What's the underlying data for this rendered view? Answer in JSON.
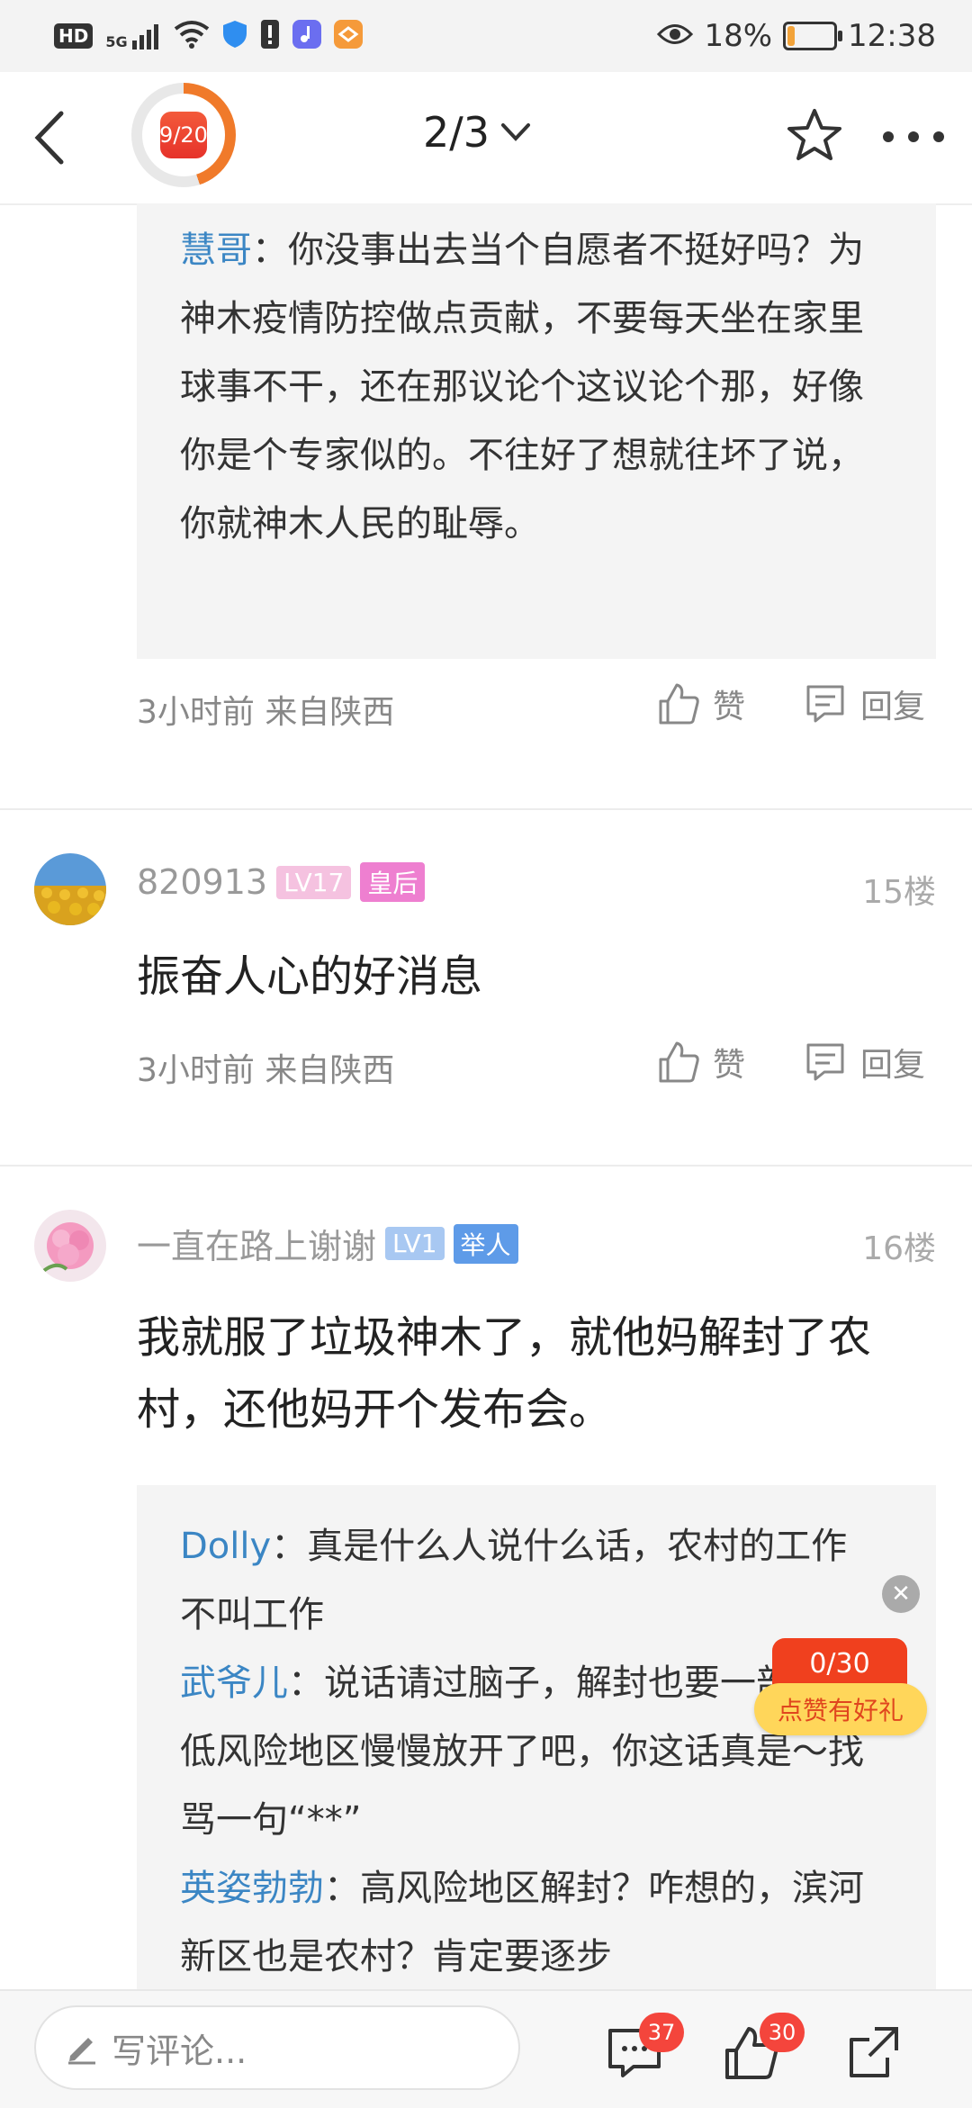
{
  "status": {
    "hd": "HD",
    "signal": "5G",
    "battery_pct": "18%",
    "battery_level": 0.18,
    "time": "12:38"
  },
  "nav": {
    "timer": "9/20",
    "timer_progress": 0.45,
    "page": "2/3"
  },
  "comment14": {
    "replies": [
      {
        "name": "慧哥",
        "text": "：你没事出去当个自愿者不挺好吗？为神木疫情防控做点贡献，不要每天坐在家里球事不干，还在那议论个这议论个那，好像你是个专家似的。不往好了想就往坏了说，你就神木人民的耻辱。"
      }
    ],
    "time": "3小时前 来自陕西",
    "like": "赞",
    "reply": "回复"
  },
  "comment15": {
    "user": "820913",
    "level": "LV17",
    "title": "皇后",
    "floor": "15楼",
    "text": "振奋人心的好消息",
    "time": "3小时前 来自陕西",
    "like": "赞",
    "reply": "回复"
  },
  "comment16": {
    "user": "一直在路上谢谢",
    "level": "LV1",
    "title": "举人",
    "floor": "16楼",
    "text": "我就服了垃圾神木了，就他妈解封了农村，还他妈开个发布会。",
    "replies": [
      {
        "name": "Dolly",
        "text": "：真是什么人说什么话，农村的工作不叫工作"
      },
      {
        "name": "武爷儿",
        "text": "：说话请过脑子，解封也要一部分从低风险地区慢慢放开了吧，你这话真是～找骂一句“**”"
      },
      {
        "name": "英姿勃勃",
        "text": "：高风险地区解封？咋想的，滨河新区也是农村？肯定要逐步"
      }
    ]
  },
  "gift": {
    "count": "0/30",
    "label": "点赞有好礼"
  },
  "bottom": {
    "placeholder": "写评论...",
    "comments_badge": "37",
    "likes_badge": "30"
  },
  "colors": {
    "accent": "#f07a2a",
    "username_blue": "#3b86c4",
    "badge_red": "#f4453c"
  }
}
